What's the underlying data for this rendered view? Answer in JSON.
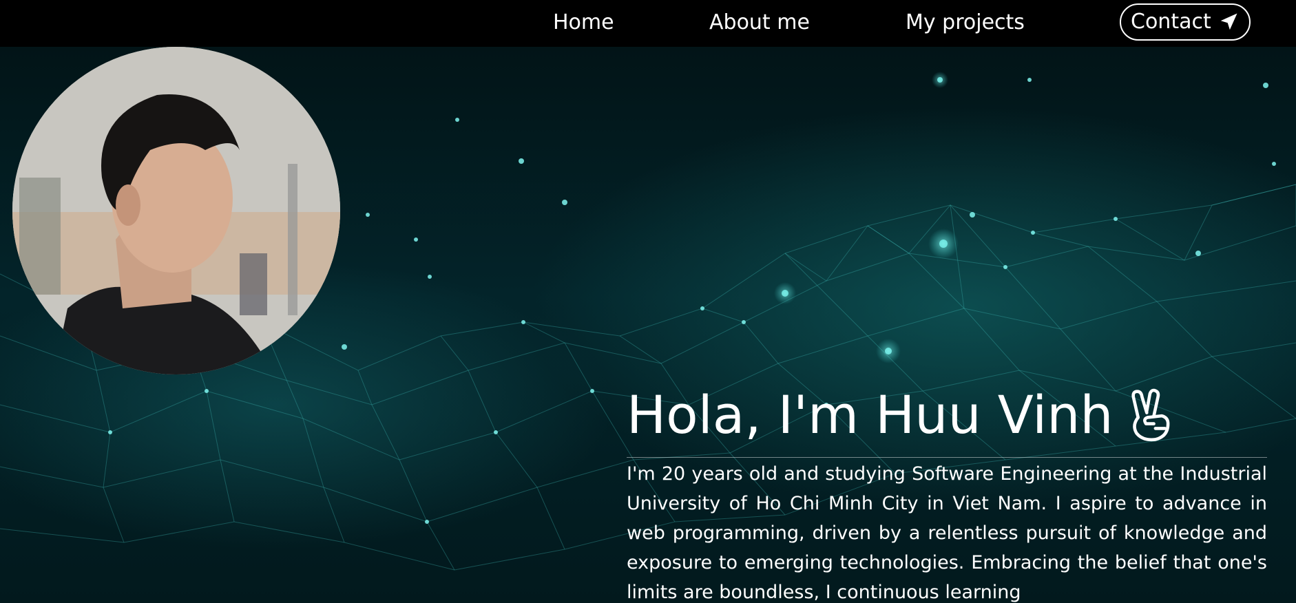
{
  "nav": {
    "home": "Home",
    "about": "About me",
    "projects": "My projects",
    "contact": "Contact",
    "contact_icon": "send-icon"
  },
  "hero": {
    "avatar_icon": "profile-photo",
    "headline": "Hola, I'm Huu Vinh",
    "headline_icon": "victory-hand-icon",
    "bio": "I'm 20 years old and studying Software Engineering at the Industrial University of Ho Chi Minh City in Viet Nam. I aspire to advance in web programming, driven by a relentless pursuit of knowledge and exposure to emerging technologies. Embracing the belief that one's limits are boundless, I continuous learning"
  },
  "colors": {
    "nav_background": "#000000",
    "accent_teal": "#3fd6d0",
    "text": "#ffffff"
  }
}
